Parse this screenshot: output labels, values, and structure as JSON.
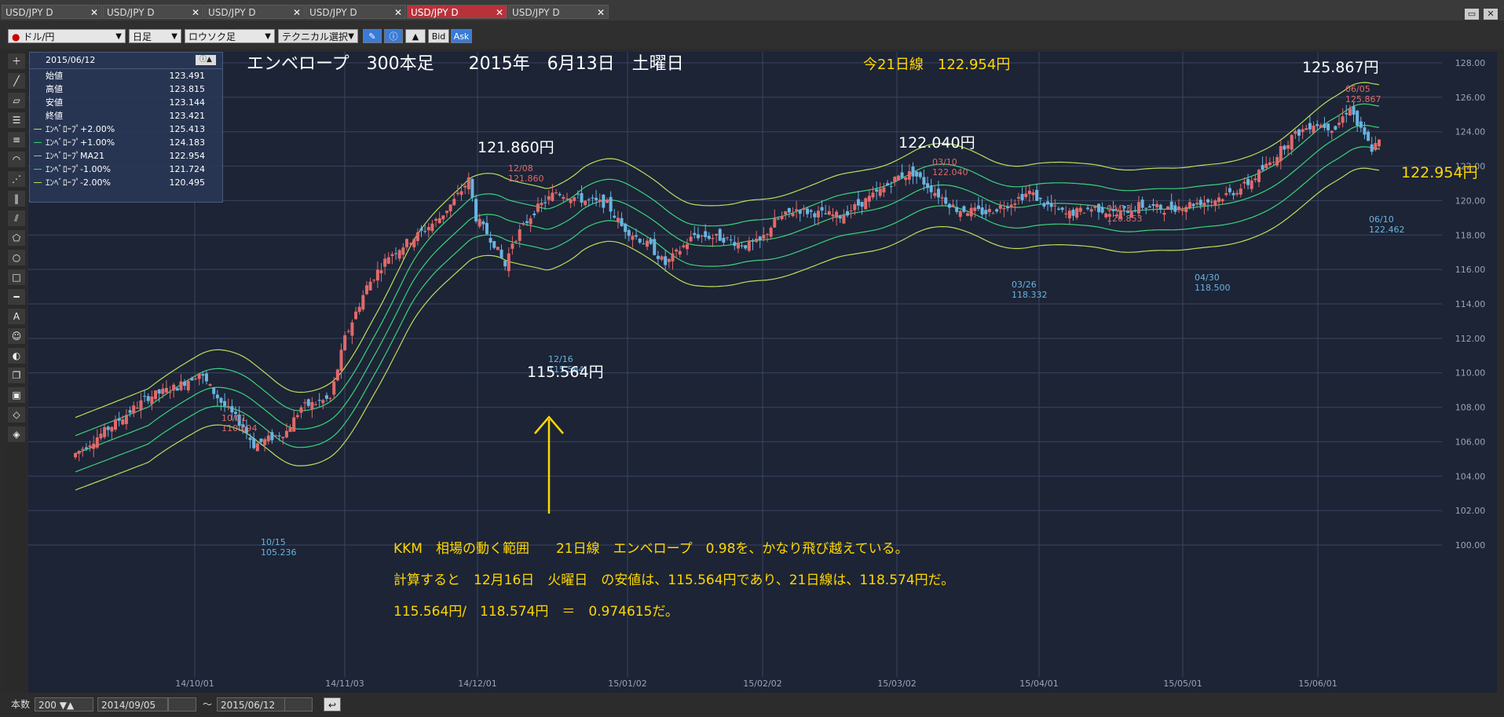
{
  "tabs": [
    {
      "label": "USD/JPY D",
      "active": false
    },
    {
      "label": "USD/JPY D",
      "active": false
    },
    {
      "label": "USD/JPY D",
      "active": false
    },
    {
      "label": "USD/JPY D",
      "active": false
    },
    {
      "label": "USD/JPY D",
      "active": true
    },
    {
      "label": "USD/JPY D",
      "active": false
    }
  ],
  "toolbar": {
    "currency": "ドル/円",
    "period": "日足",
    "chart_type": "ロウソク足",
    "technical": "テクニカル選択",
    "bid": "Bid",
    "ask": "Ask"
  },
  "infobox": {
    "date": "2015/06/12",
    "rows": [
      {
        "label": "始値",
        "value": "123.491"
      },
      {
        "label": "高値",
        "value": "123.815"
      },
      {
        "label": "安値",
        "value": "123.144"
      },
      {
        "label": "終値",
        "value": "123.421"
      },
      {
        "label": "ｴﾝﾍﾞﾛｰﾌﾟ+2.00%",
        "value": "125.413",
        "color": "#b8e05a"
      },
      {
        "label": "ｴﾝﾍﾞﾛｰﾌﾟ+1.00%",
        "value": "124.183",
        "color": "#3cd27a"
      },
      {
        "label": "ｴﾝﾍﾞﾛｰﾌﾟMA21",
        "value": "122.954",
        "color": "#b0b0b0"
      },
      {
        "label": "ｴﾝﾍﾞﾛｰﾌﾟ-1.00%",
        "value": "121.724",
        "color": "#3cd27a"
      },
      {
        "label": "ｴﾝﾍﾞﾛｰﾌﾟ-2.00%",
        "value": "120.495",
        "color": "#b8e05a"
      }
    ]
  },
  "annotations": {
    "title": "エンベロープ　300本足　　2015年　6月13日　土曜日",
    "ma_note": "今21日線　122.954円",
    "p1": "121.860円",
    "p2": "122.040円",
    "p3": "125.867円",
    "p4": "115.564円",
    "p5": "122.954円",
    "line1": "KKM　相場の動く範囲　　21日線　エンベロープ　0.98を、かなり飛び越えている。",
    "line2": "計算すると　12月16日　火曜日　の安値は、115.564円であり、21日線は、118.574円だ。",
    "line3": "115.564円/　118.574円　＝　0.974615だ。"
  },
  "statusbar": {
    "count_label": "本数",
    "count_value": "200",
    "from": "2014/09/05",
    "tilde": "～",
    "to": "2015/06/12"
  },
  "colors": {
    "background": "#1c2436",
    "up_candle": "#e06a6a",
    "down_candle": "#6ab4e0",
    "envelope_2": "#b8e05a",
    "envelope_1": "#3cd27a",
    "yellow_text": "#ffd700"
  },
  "chart_data": {
    "type": "candlestick",
    "y_ticks": [
      "128.00",
      "126.00",
      "124.00",
      "122.00",
      "120.00",
      "118.00",
      "116.00",
      "114.00",
      "112.00",
      "110.00",
      "108.00",
      "106.00",
      "104.00",
      "102.00",
      "100.00"
    ],
    "ylim": [
      99,
      128.5
    ],
    "x_ticks": [
      "14/10/01",
      "14/11/03",
      "14/12/01",
      "15/01/02",
      "15/02/02",
      "15/03/02",
      "15/04/01",
      "15/05/01",
      "15/06/01"
    ],
    "annotations": [
      {
        "date": "10/01",
        "value": "110.094",
        "kind": "high"
      },
      {
        "date": "10/15",
        "value": "105.236",
        "kind": "low"
      },
      {
        "date": "12/08",
        "value": "121.860",
        "kind": "high"
      },
      {
        "date": "12/16",
        "value": "115.564",
        "kind": "low"
      },
      {
        "date": "03/10",
        "value": "122.040",
        "kind": "high"
      },
      {
        "date": "03/26",
        "value": "118.332",
        "kind": "low"
      },
      {
        "date": "04/13",
        "value": "120.853",
        "kind": "high"
      },
      {
        "date": "04/30",
        "value": "118.500",
        "kind": "low"
      },
      {
        "date": "06/05",
        "value": "125.867",
        "kind": "high"
      },
      {
        "date": "06/10",
        "value": "122.462",
        "kind": "low"
      }
    ],
    "anchors": [
      [
        0,
        105.3
      ],
      [
        8,
        106.6
      ],
      [
        20,
        108.6
      ],
      [
        28,
        109.2
      ],
      [
        34,
        110.0
      ],
      [
        40,
        108.3
      ],
      [
        46,
        106.9
      ],
      [
        49,
        105.8
      ],
      [
        58,
        106.6
      ],
      [
        62,
        108.0
      ],
      [
        70,
        108.5
      ],
      [
        74,
        112.0
      ],
      [
        80,
        115.0
      ],
      [
        86,
        116.8
      ],
      [
        94,
        118.0
      ],
      [
        100,
        119.0
      ],
      [
        104,
        120.0
      ],
      [
        108,
        121.2
      ],
      [
        110,
        119.0
      ],
      [
        115,
        117.5
      ],
      [
        118,
        116.2
      ],
      [
        120,
        117.6
      ],
      [
        126,
        119.4
      ],
      [
        132,
        120.5
      ],
      [
        140,
        120.0
      ],
      [
        146,
        119.8
      ],
      [
        150,
        118.5
      ],
      [
        158,
        117.3
      ],
      [
        162,
        116.3
      ],
      [
        170,
        118.0
      ],
      [
        178,
        117.8
      ],
      [
        184,
        117.4
      ],
      [
        188,
        117.6
      ],
      [
        192,
        118.8
      ],
      [
        198,
        119.5
      ],
      [
        202,
        119.3
      ],
      [
        210,
        119.1
      ],
      [
        220,
        120.4
      ],
      [
        226,
        121.4
      ],
      [
        230,
        121.6
      ],
      [
        236,
        120.5
      ],
      [
        242,
        119.5
      ],
      [
        250,
        119.3
      ],
      [
        256,
        119.8
      ],
      [
        262,
        120.5
      ],
      [
        266,
        119.8
      ],
      [
        272,
        119.2
      ],
      [
        280,
        119.6
      ],
      [
        286,
        119.2
      ],
      [
        292,
        119.7
      ],
      [
        300,
        119.5
      ],
      [
        306,
        119.8
      ],
      [
        312,
        120.0
      ],
      [
        318,
        120.5
      ],
      [
        322,
        121.0
      ],
      [
        328,
        122.2
      ],
      [
        334,
        123.7
      ],
      [
        340,
        124.5
      ],
      [
        346,
        124.2
      ],
      [
        350,
        125.5
      ],
      [
        352,
        124.4
      ],
      [
        356,
        123.0
      ],
      [
        358,
        123.4
      ]
    ]
  }
}
